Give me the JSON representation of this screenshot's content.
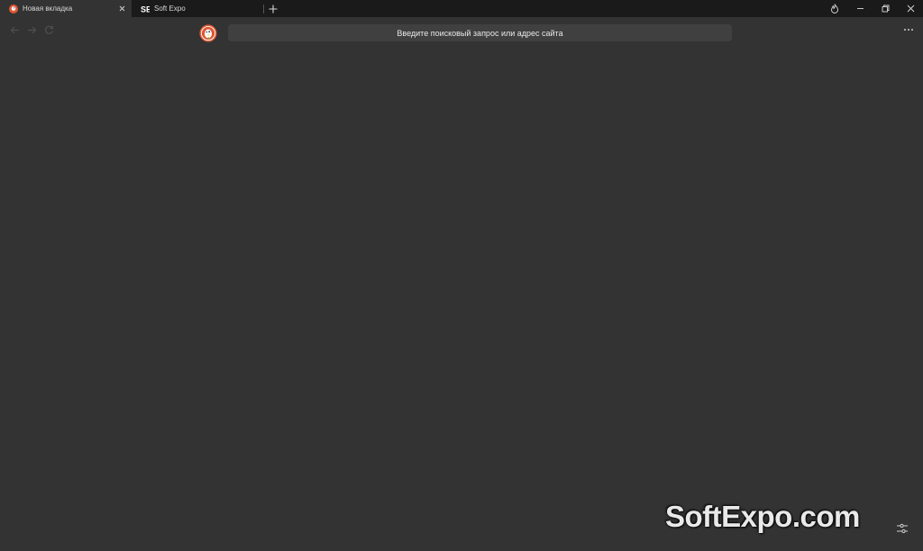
{
  "tabs": [
    {
      "title": "Новая вкладка",
      "favicon": "duckduckgo-icon",
      "active": true
    },
    {
      "title": "Soft Expo",
      "favicon": "softexpo-icon",
      "active": false
    }
  ],
  "toolbar": {
    "search_placeholder": "Введите поисковый запрос или адрес сайта"
  },
  "watermark": "SoftExpo.com",
  "colors": {
    "background": "#333333",
    "tabbar": "#1a1a1a",
    "omnibox": "#404040",
    "duckduckgo_orange": "#de5833"
  },
  "icons": [
    "back-icon",
    "forward-icon",
    "reload-icon",
    "fire-icon",
    "minimize-icon",
    "restore-icon",
    "close-icon",
    "more-icon",
    "settings-icon"
  ]
}
